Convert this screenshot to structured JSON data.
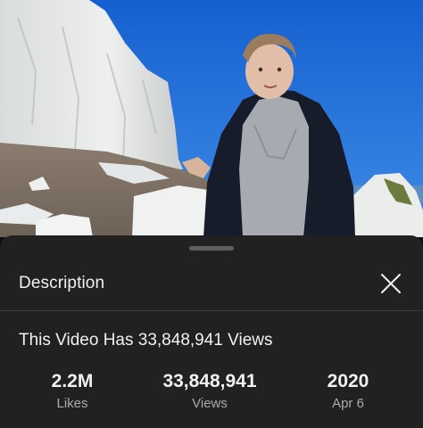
{
  "sheet": {
    "title": "Description",
    "close_icon": "close-icon"
  },
  "video": {
    "title": "This Video Has 33,848,941 Views"
  },
  "stats": {
    "likes": {
      "value": "2.2M",
      "label": "Likes"
    },
    "views": {
      "value": "33,848,941",
      "label": "Views"
    },
    "date": {
      "year": "2020",
      "day": "Apr 6"
    }
  },
  "colors": {
    "sheet_background": "#212121",
    "text_primary": "#f1f1f1",
    "text_secondary": "#aaaaaa",
    "sky": "#1f6fd8"
  }
}
